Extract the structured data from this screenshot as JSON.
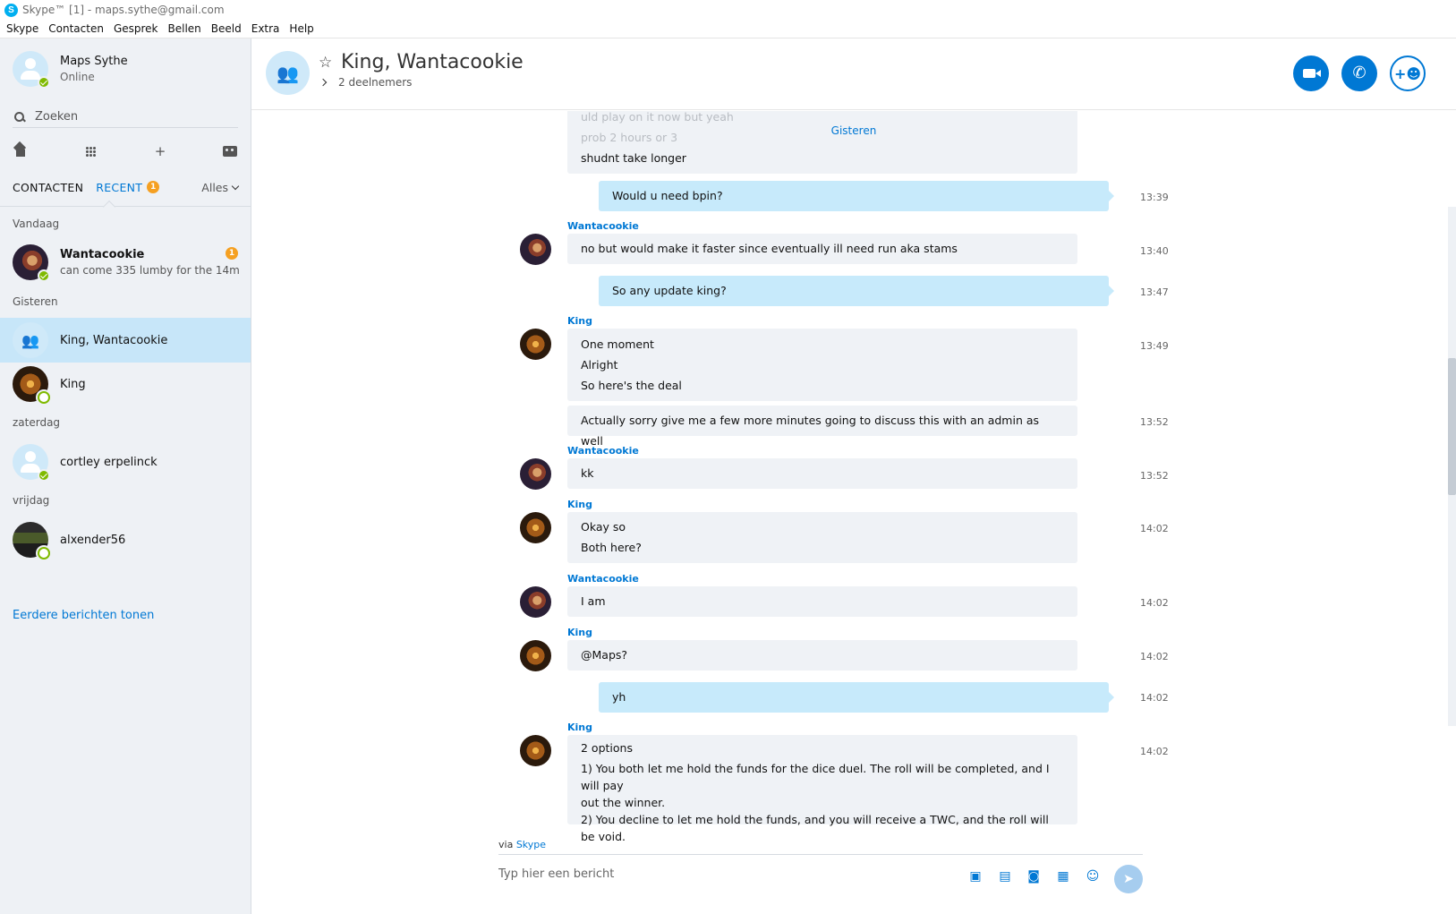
{
  "window": {
    "title": "Skype™ [1] - maps.sythe@gmail.com",
    "logo": "S"
  },
  "menu": [
    "Skype",
    "Contacten",
    "Gesprek",
    "Bellen",
    "Beeld",
    "Extra",
    "Help"
  ],
  "profile": {
    "name": "Maps Sythe",
    "status": "Online"
  },
  "search": {
    "placeholder": "Zoeken"
  },
  "tabs": {
    "contacts": "CONTACTEN",
    "recent": "RECENT",
    "recent_badge": "1",
    "filter": "Alles"
  },
  "sections": {
    "today": "Vandaag",
    "yesterday": "Gisteren",
    "saturday": "zaterdag",
    "friday": "vrijdag"
  },
  "conversations": [
    {
      "name": "Wantacookie",
      "preview": "can come 335 lumby for the 14m",
      "badge": "1"
    },
    {
      "name": "King, Wantacookie"
    },
    {
      "name": "King"
    },
    {
      "name": "cortley erpelinck"
    },
    {
      "name": "alxender56"
    }
  ],
  "more_link": "Eerdere berichten tonen",
  "chat": {
    "title": "King, Wantacookie",
    "participants": "2 deelnemers",
    "day_separator": "Gisteren",
    "faint_lines": [
      "uld play on it now but yeah",
      "prob 2 hours or 3"
    ],
    "messages": [
      {
        "sender": "",
        "lines": [
          "shudnt take longer"
        ],
        "time": ""
      },
      {
        "sender": "",
        "lines": [
          "Would u need bpin?"
        ],
        "time": "13:39"
      },
      {
        "sender": "Wantacookie",
        "lines": [
          "no but would make it faster since eventually ill need run aka stams"
        ],
        "time": "13:40"
      },
      {
        "sender": "",
        "lines": [
          "So any update king?"
        ],
        "time": "13:47"
      },
      {
        "sender": "King",
        "lines": [
          "One moment",
          "Alright",
          "So here's the deal"
        ],
        "time": "13:49"
      },
      {
        "sender": "",
        "lines": [
          "Actually sorry give me a few more minutes going to discuss this with an admin as well"
        ],
        "time": "13:52"
      },
      {
        "sender": "Wantacookie",
        "lines": [
          "kk"
        ],
        "time": "13:52"
      },
      {
        "sender": "King",
        "lines": [
          "Okay so",
          "Both here?"
        ],
        "time": "14:02"
      },
      {
        "sender": "Wantacookie",
        "lines": [
          "I am"
        ],
        "time": "14:02"
      },
      {
        "sender": "King",
        "lines": [
          "@Maps?"
        ],
        "time": "14:02"
      },
      {
        "sender": "",
        "lines": [
          "yh"
        ],
        "time": "14:02"
      },
      {
        "sender": "King",
        "lines": [
          "2 options",
          "1) You both let me hold the funds for the dice duel. The roll will be completed, and I will pay",
          "out the winner.",
          "2) You decline to let me hold the funds, and you will receive a TWC, and the roll will be void."
        ],
        "time": "14:02"
      }
    ]
  },
  "composer": {
    "via": "via",
    "via_app": "Skype",
    "placeholder": "Typ hier een bericht"
  },
  "colors": {
    "accent": "#0078d4",
    "sidebar_bg": "#eef1f5",
    "my_bubble": "#c7eafb",
    "their_bubble": "#eff2f6",
    "badge": "#f5a021",
    "online": "#7fba00"
  }
}
